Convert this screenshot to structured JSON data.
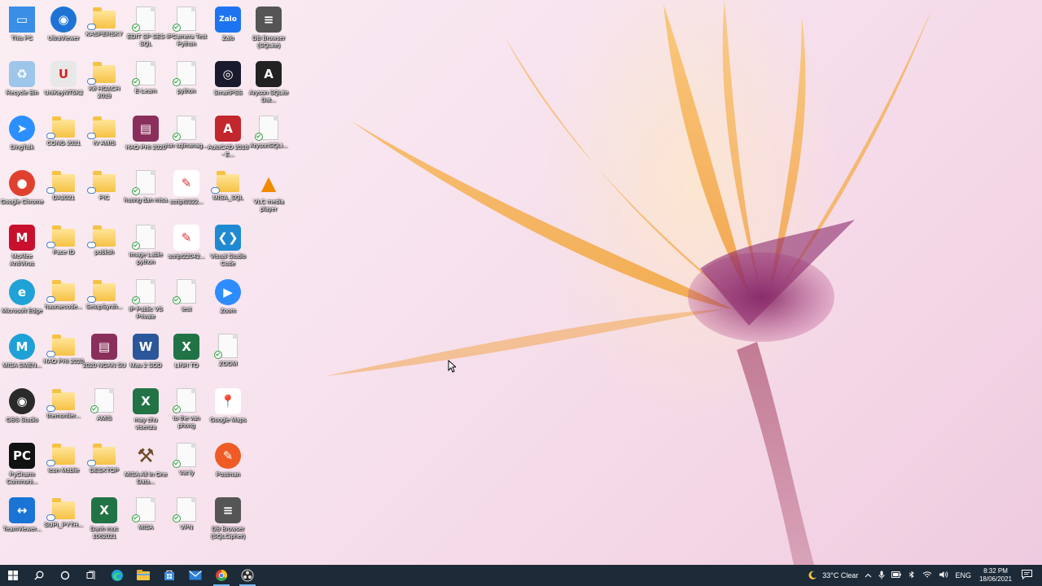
{
  "desktop": {
    "icons": [
      {
        "label": "This PC",
        "type": "pc"
      },
      {
        "label": "UltraViewer",
        "type": "ultraviewer"
      },
      {
        "label": "KASPERSKY",
        "type": "folder"
      },
      {
        "label": "EDIT SP SES SQL",
        "type": "doc"
      },
      {
        "label": "IPCamera Test Python",
        "type": "doc"
      },
      {
        "label": "Zalo",
        "type": "zalo"
      },
      {
        "label": "DB Browser (SQLite)",
        "type": "db"
      },
      {
        "label": "Recycle Bin",
        "type": "recycle"
      },
      {
        "label": "UniKeyNT5K2",
        "type": "unikey"
      },
      {
        "label": "Kế HOẠCH 2019",
        "type": "folder"
      },
      {
        "label": "E-Learn",
        "type": "doc"
      },
      {
        "label": "python",
        "type": "doc"
      },
      {
        "label": "SmartPSS",
        "type": "smartpss"
      },
      {
        "label": "Aryson SQLite Dat...",
        "type": "aryson"
      },
      {
        "label": "DingTalk",
        "type": "dingtalk"
      },
      {
        "label": "CONG 2021",
        "type": "folder"
      },
      {
        "label": "IV AMIS",
        "type": "folder"
      },
      {
        "label": "HAO PHI 2020",
        "type": "winrar"
      },
      {
        "label": "run sqlmanag...",
        "type": "doc"
      },
      {
        "label": "AutoCAD 2018 - E...",
        "type": "autocad"
      },
      {
        "label": "ArysonSQLi...",
        "type": "doc"
      },
      {
        "label": "Google Chrome",
        "type": "chrome"
      },
      {
        "label": "DA2021",
        "type": "folder"
      },
      {
        "label": "PIC",
        "type": "folder"
      },
      {
        "label": "huong dan misa",
        "type": "doc"
      },
      {
        "label": "script0322...",
        "type": "script"
      },
      {
        "label": "MISA_SQL",
        "type": "folder"
      },
      {
        "label": "VLC media player",
        "type": "vlc"
      },
      {
        "label": "McAfee AntiVirus",
        "type": "mcafee"
      },
      {
        "label": "Face ID",
        "type": "folder"
      },
      {
        "label": "publish",
        "type": "folder"
      },
      {
        "label": "Image Lable python",
        "type": "doc"
      },
      {
        "label": "script22042...",
        "type": "script"
      },
      {
        "label": "Visual Studio Code",
        "type": "vscode"
      },
      {
        "label": "Microsoft Edge",
        "type": "edge"
      },
      {
        "label": "hauraecode...",
        "type": "folder"
      },
      {
        "label": "SetupSynth...",
        "type": "folder"
      },
      {
        "label": "IP Public VS Private",
        "type": "doc"
      },
      {
        "label": "test",
        "type": "doc"
      },
      {
        "label": "Zoom",
        "type": "zoom"
      },
      {
        "label": "MISA SMEN...",
        "type": "misa"
      },
      {
        "label": "HAO PHI 2020",
        "type": "folder"
      },
      {
        "label": "2020 NGAN SU",
        "type": "winrar"
      },
      {
        "label": "Mau 2 SOD",
        "type": "word"
      },
      {
        "label": "LINH TO",
        "type": "excel"
      },
      {
        "label": "ZOOM",
        "type": "doc"
      },
      {
        "label": "OBS Studio",
        "type": "obs"
      },
      {
        "label": "themontler...",
        "type": "folder"
      },
      {
        "label": "AMIS",
        "type": "doc"
      },
      {
        "label": "may chu visenza",
        "type": "excel"
      },
      {
        "label": "to the van phong",
        "type": "doc"
      },
      {
        "label": "Google Maps",
        "type": "maps"
      },
      {
        "label": "PyCharm Communi...",
        "type": "pycharm"
      },
      {
        "label": "Icon Mobile",
        "type": "folder"
      },
      {
        "label": "DESKTOP",
        "type": "folder"
      },
      {
        "label": "MISA All In One Data...",
        "type": "misatools"
      },
      {
        "label": "Vat ly",
        "type": "doc"
      },
      {
        "label": "Postman",
        "type": "postman"
      },
      {
        "label": "TeamViewer...",
        "type": "teamviewer"
      },
      {
        "label": "SUPI_PYTH...",
        "type": "folder"
      },
      {
        "label": "Danh muc 1062021",
        "type": "excel"
      },
      {
        "label": "MISA",
        "type": "doc"
      },
      {
        "label": "VPN",
        "type": "doc"
      },
      {
        "label": "DB Browser (SQLCipher)",
        "type": "db"
      }
    ]
  },
  "taskbar": {
    "start_icon": "windows-icon",
    "items": [
      {
        "name": "search-icon"
      },
      {
        "name": "cortana-icon"
      },
      {
        "name": "task-view-icon"
      },
      {
        "name": "edge-icon"
      },
      {
        "name": "file-explorer-icon"
      },
      {
        "name": "store-icon"
      },
      {
        "name": "mail-icon"
      },
      {
        "name": "chrome-icon"
      },
      {
        "name": "obs-icon"
      }
    ],
    "weather": {
      "temp": "33°C",
      "condition": "Clear"
    },
    "language": "ENG",
    "time": "8:32 PM",
    "date": "18/06/2021"
  }
}
